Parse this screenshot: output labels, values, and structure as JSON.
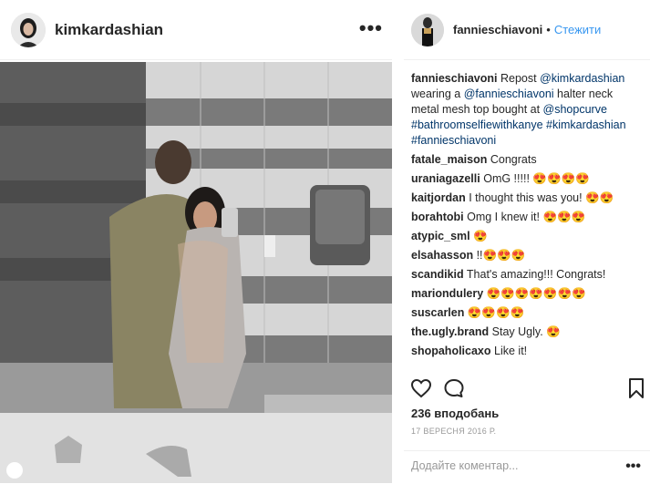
{
  "post": {
    "author": "kimkardashian",
    "more_icon": "•••",
    "photo_icon": "photo-image"
  },
  "sidebar": {
    "author": "fannieschiavoni",
    "bullet": "•",
    "follow_label": "Стежити"
  },
  "caption": {
    "user": "fannieschiavoni",
    "parts": [
      "Repost ",
      "@kimkardashian",
      " wearing a ",
      "@fannieschiavoni",
      " halter neck metal mesh top bought at ",
      "@shopcurve",
      " ",
      "#bathroomselfiewithkanye",
      " ",
      "#kimkardashian",
      " ",
      "#fannieschiavoni"
    ]
  },
  "comments": [
    {
      "user": "fatale_maison",
      "text": "Congrats"
    },
    {
      "user": "uraniagazelli",
      "text": "OmG !!!!! 😍😍😍😍"
    },
    {
      "user": "kaitjordan",
      "text": "I thought this was you! 😍😍"
    },
    {
      "user": "borahtobi",
      "text": "Omg I knew it! 😍😍😍"
    },
    {
      "user": "atypic_sml",
      "text": "😍"
    },
    {
      "user": "elsahasson",
      "text": "!!😍😍😍"
    },
    {
      "user": "scandikid",
      "text": "That's amazing!!! Congrats!"
    },
    {
      "user": "mariondulery",
      "text": "😍😍😍😍😍😍😍"
    },
    {
      "user": "suscarlen",
      "text": "😍😍😍😍"
    },
    {
      "user": "the.ugly.brand",
      "text": "Stay Ugly. 😍"
    },
    {
      "user": "shopaholicaxo",
      "text": "Like it!"
    }
  ],
  "likes": "236 вподобань",
  "date": "17 ВЕРЕСНЯ 2016 Р.",
  "comment_input": {
    "placeholder": "Додайте коментар..."
  },
  "comment_more_icon": "•••",
  "icons": {
    "like": "heart-icon",
    "comment": "comment-bubble-icon",
    "save": "bookmark-icon"
  },
  "colors": {
    "link": "#003569",
    "follow": "#3897f0",
    "date": "#999999"
  }
}
